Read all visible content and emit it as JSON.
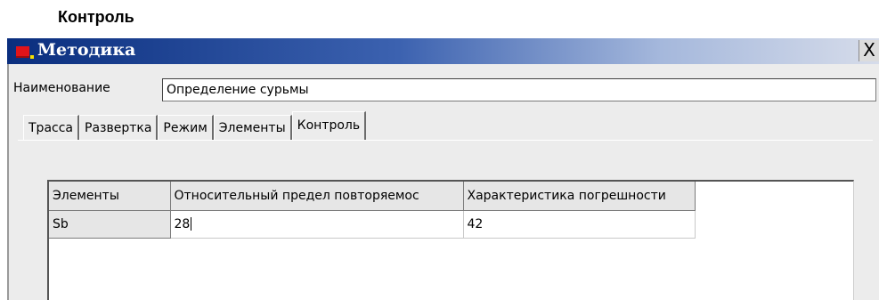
{
  "heading": "Контроль",
  "window": {
    "title": "Методика",
    "close_label": "X"
  },
  "name_field": {
    "label": "Наименование",
    "value": "Определение сурьмы"
  },
  "tabs": [
    {
      "label": "Трасса"
    },
    {
      "label": "Развертка"
    },
    {
      "label": "Режим"
    },
    {
      "label": "Элементы"
    },
    {
      "label": "Контроль",
      "active": true
    }
  ],
  "grid": {
    "columns": [
      "Элементы",
      "Относительный предел повторяемос",
      "Характеристика погрешности"
    ],
    "rows": [
      {
        "element": "Sb",
        "repeatability": "28",
        "error": "42"
      }
    ]
  }
}
